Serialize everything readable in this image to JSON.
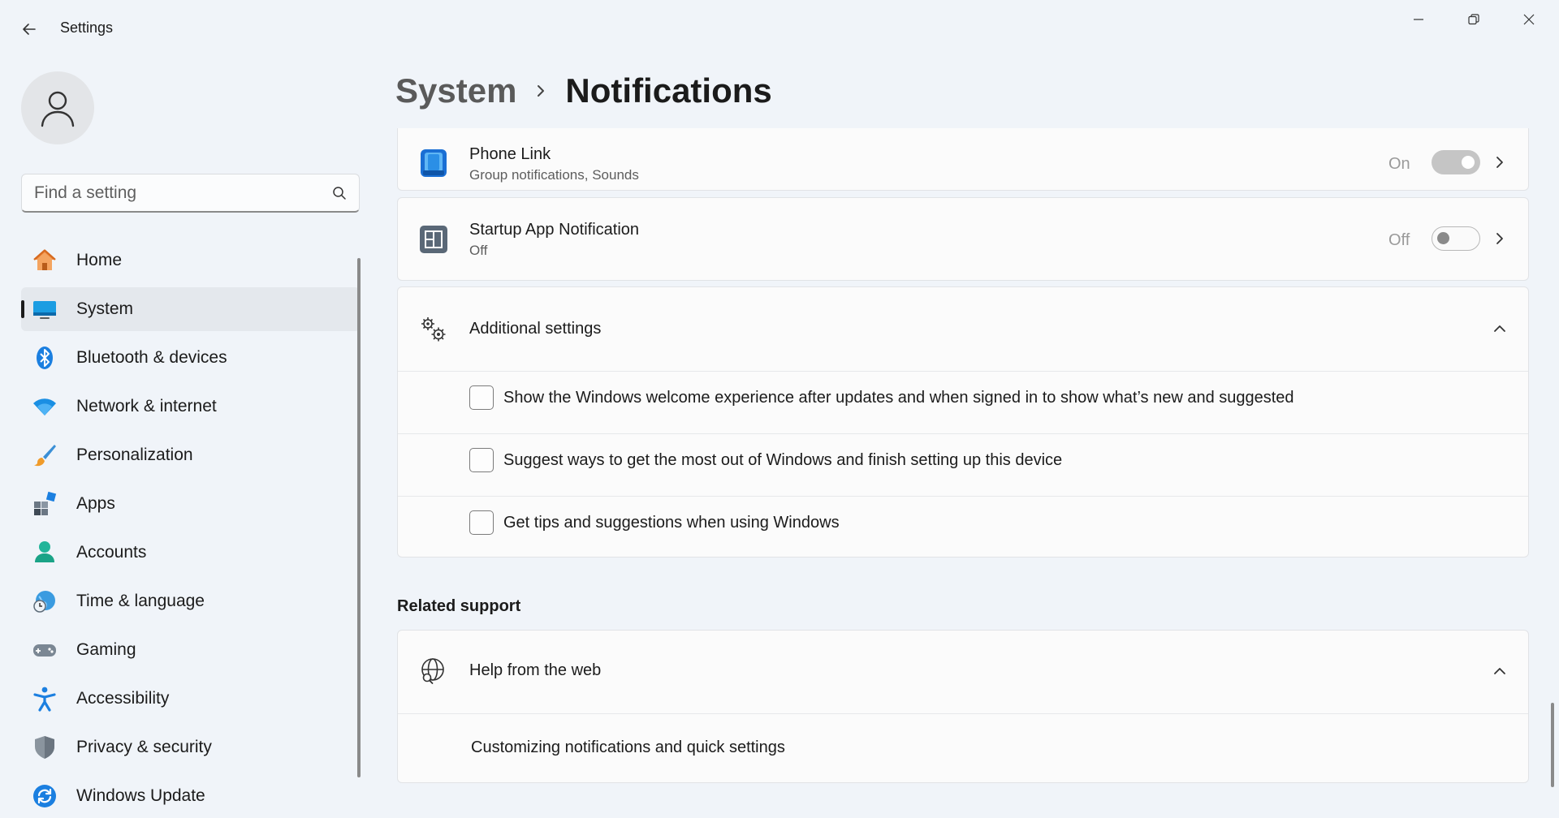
{
  "window": {
    "title": "Settings",
    "controls": {
      "minimize": "minimize-icon",
      "maximize": "restore-icon",
      "close": "close-icon"
    }
  },
  "search": {
    "placeholder": "Find a setting"
  },
  "sidebar": {
    "items": [
      {
        "label": "Home",
        "icon": "home-icon"
      },
      {
        "label": "System",
        "icon": "system-icon",
        "active": true
      },
      {
        "label": "Bluetooth & devices",
        "icon": "bluetooth-icon"
      },
      {
        "label": "Network & internet",
        "icon": "wifi-icon"
      },
      {
        "label": "Personalization",
        "icon": "brush-icon"
      },
      {
        "label": "Apps",
        "icon": "apps-icon"
      },
      {
        "label": "Accounts",
        "icon": "person-icon"
      },
      {
        "label": "Time & language",
        "icon": "globe-clock-icon"
      },
      {
        "label": "Gaming",
        "icon": "gamepad-icon"
      },
      {
        "label": "Accessibility",
        "icon": "accessibility-icon"
      },
      {
        "label": "Privacy & security",
        "icon": "shield-icon"
      },
      {
        "label": "Windows Update",
        "icon": "update-icon"
      }
    ]
  },
  "breadcrumb": {
    "parent": "System",
    "current": "Notifications"
  },
  "apps": [
    {
      "name": "Phone Link",
      "detail": "Group notifications, Sounds",
      "state": "On",
      "on": true
    },
    {
      "name": "Startup App Notification",
      "detail": "Off",
      "state": "Off",
      "on": false
    }
  ],
  "additional": {
    "title": "Additional settings",
    "options": [
      {
        "label": "Show the Windows welcome experience after updates and when signed in to show what’s new and suggested",
        "checked": false
      },
      {
        "label": "Suggest ways to get the most out of Windows and finish setting up this device",
        "checked": false
      },
      {
        "label": "Get tips and suggestions when using Windows",
        "checked": false
      }
    ]
  },
  "related": {
    "title": "Related support",
    "help_title": "Help from the web",
    "links": [
      "Customizing notifications and quick settings"
    ]
  },
  "colors": {
    "accent": "#0067c0",
    "background": "#f0f4f9",
    "card": "#fbfbfb"
  }
}
